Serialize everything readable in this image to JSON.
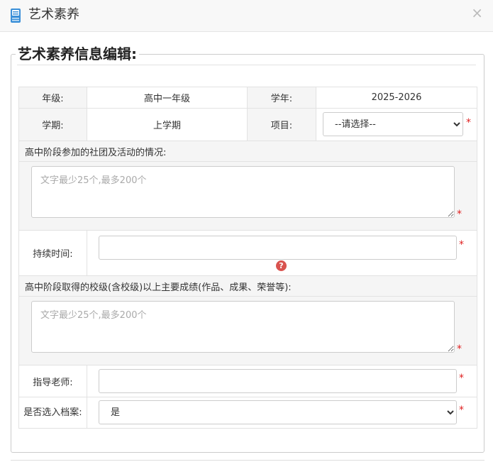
{
  "dialog": {
    "title": "艺术素养",
    "close": "×"
  },
  "form": {
    "legend": "艺术素养信息编辑:",
    "grade_label": "年级:",
    "grade_value": "高中一年级",
    "year_label": "学年:",
    "year_value": "2025-2026",
    "term_label": "学期:",
    "term_value": "上学期",
    "project_label": "项目:",
    "project_selected": "--请选择--",
    "activities_label": "高中阶段参加的社团及活动的情况:",
    "activities_placeholder": "文字最少25个,最多200个",
    "duration_label": "持续时间:",
    "duration_value": "",
    "achievements_label": "高中阶段取得的校级(含校级)以上主要成绩(作品、成果、荣誉等):",
    "achievements_placeholder": "文字最少25个,最多200个",
    "teacher_label": "指导老师:",
    "teacher_value": "",
    "archive_label": "是否选入档案:",
    "archive_selected": "是",
    "required_mark": "*",
    "help_glyph": "?"
  },
  "colors": {
    "required": "#e02020",
    "help": "#d9534f",
    "icon": "#3a8fd8"
  }
}
